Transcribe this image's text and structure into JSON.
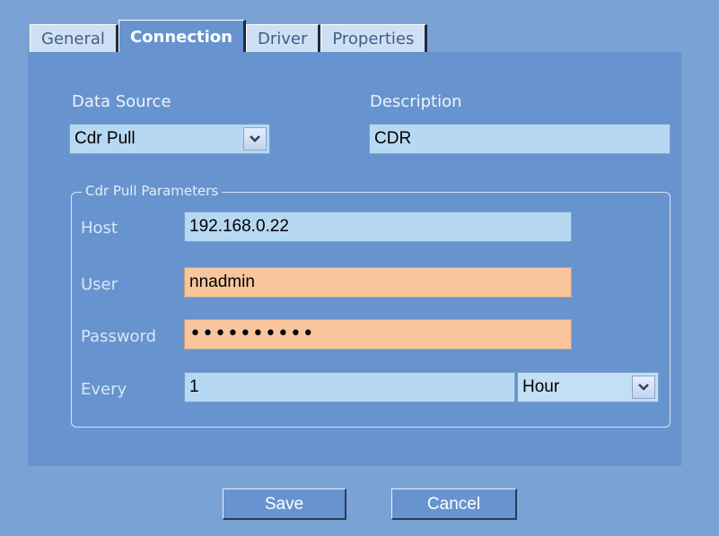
{
  "tabs": [
    {
      "label": "General",
      "active": false
    },
    {
      "label": "Connection",
      "active": true
    },
    {
      "label": "Driver",
      "active": false
    },
    {
      "label": "Properties",
      "active": false
    }
  ],
  "data_source": {
    "label": "Data Source",
    "selected": "Cdr Pull"
  },
  "description": {
    "label": "Description",
    "value": "CDR"
  },
  "params": {
    "legend": "Cdr Pull Parameters",
    "host_label": "Host",
    "host_value": "192.168.0.22",
    "user_label": "User",
    "user_value": "nnadmin",
    "password_label": "Password",
    "password_value": "••••••••••",
    "every_label": "Every",
    "every_value": "1",
    "every_unit": "Hour"
  },
  "buttons": {
    "save": "Save",
    "cancel": "Cancel"
  },
  "colors": {
    "panel": "#6794cf",
    "field_blue": "#b7d8f3",
    "field_required": "#f8c59c"
  }
}
